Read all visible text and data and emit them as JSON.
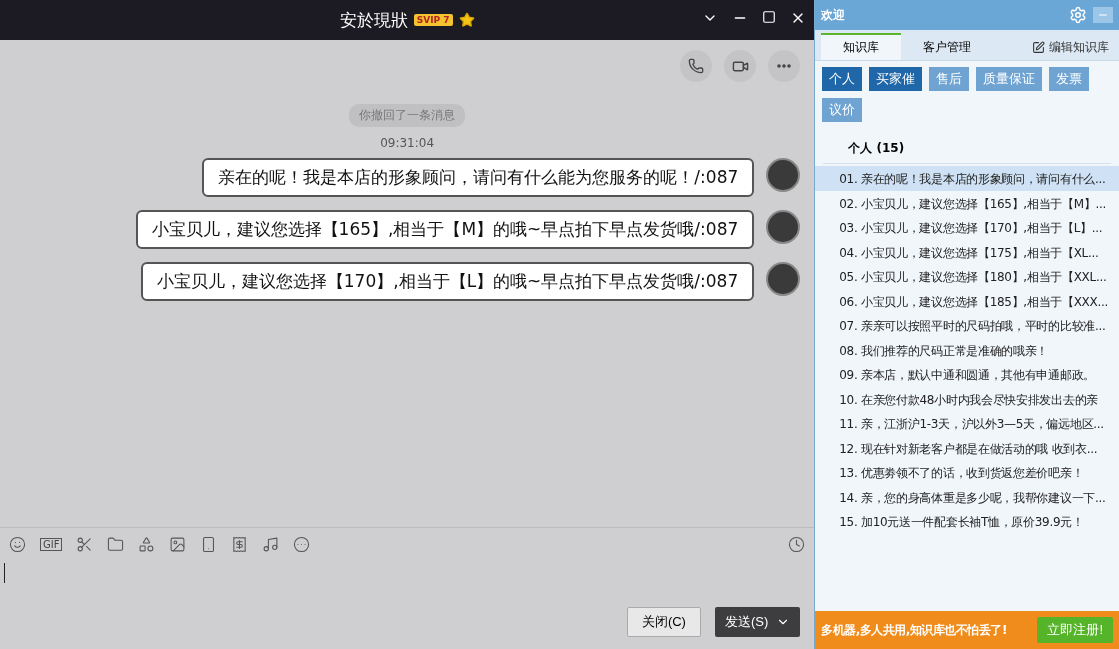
{
  "chat": {
    "title": "安於現狀",
    "vip_badge": "SVIP 7",
    "notice": "你撤回了一条消息",
    "time": "09:31:04",
    "messages": [
      {
        "text": "亲在的呢！我是本店的形象顾问，请问有什么能为您服务的呢！/:087"
      },
      {
        "text": "小宝贝儿，建议您选择【165】,相当于【M】的哦~早点拍下早点发货哦/:087"
      },
      {
        "text": "小宝贝儿，建议您选择【170】,相当于【L】的哦~早点拍下早点发货哦/:087"
      }
    ],
    "toolbar": [
      {
        "kind": "smile"
      },
      {
        "kind": "gif",
        "label": "GIF"
      },
      {
        "kind": "scissors"
      },
      {
        "kind": "folder"
      },
      {
        "kind": "shapes"
      },
      {
        "kind": "image"
      },
      {
        "kind": "shake"
      },
      {
        "kind": "money"
      },
      {
        "kind": "music"
      },
      {
        "kind": "more"
      }
    ],
    "close_button": "关闭(C)",
    "send_button": "发送(S)"
  },
  "panel": {
    "title": "欢迎",
    "tabs": [
      {
        "label": "知识库",
        "selected": true
      },
      {
        "label": "客户管理",
        "selected": false
      }
    ],
    "edit_link": "编辑知识库",
    "categories": [
      {
        "label": "个人",
        "selected": true
      },
      {
        "label": "买家催",
        "selected": true
      },
      {
        "label": "售后",
        "selected": false
      },
      {
        "label": "质量保证",
        "selected": false
      },
      {
        "label": "发票",
        "selected": false
      },
      {
        "label": "议价",
        "selected": false
      }
    ],
    "group_heading": "个人 (15)",
    "items": [
      {
        "text": "01. 亲在的呢！我是本店的形象顾问，请问有什么...",
        "selected": true
      },
      {
        "text": "02. 小宝贝儿，建议您选择【165】,相当于【M】...",
        "selected": false
      },
      {
        "text": "03. 小宝贝儿，建议您选择【170】,相当于【L】...",
        "selected": false
      },
      {
        "text": "04. 小宝贝儿，建议您选择【175】,相当于【XL...",
        "selected": false
      },
      {
        "text": "05. 小宝贝儿，建议您选择【180】,相当于【XXL...",
        "selected": false
      },
      {
        "text": "06. 小宝贝儿，建议您选择【185】,相当于【XXX...",
        "selected": false
      },
      {
        "text": "07. 亲亲可以按照平时的尺码拍哦，平时的比较准...",
        "selected": false
      },
      {
        "text": "08. 我们推荐的尺码正常是准确的哦亲！",
        "selected": false
      },
      {
        "text": "09. 亲本店，默认中通和圆通，其他有申通邮政。",
        "selected": false
      },
      {
        "text": "10. 在亲您付款48小时内我会尽快安排发出去的亲",
        "selected": false
      },
      {
        "text": "11. 亲，江浙沪1-3天，沪以外3—5天，偏远地区...",
        "selected": false
      },
      {
        "text": "12. 现在针对新老客户都是在做活动的哦 收到衣...",
        "selected": false
      },
      {
        "text": "13. 优惠劵领不了的话，收到货返您差价吧亲！",
        "selected": false
      },
      {
        "text": "14. 亲，您的身高体重是多少呢，我帮你建议一下...",
        "selected": false
      },
      {
        "text": "15. 加10元送一件配套长袖T恤，原价39.9元！",
        "selected": false
      }
    ],
    "promo": "多机器,多人共用,知识库也不怕丢了!",
    "register_button": "立即注册!"
  }
}
